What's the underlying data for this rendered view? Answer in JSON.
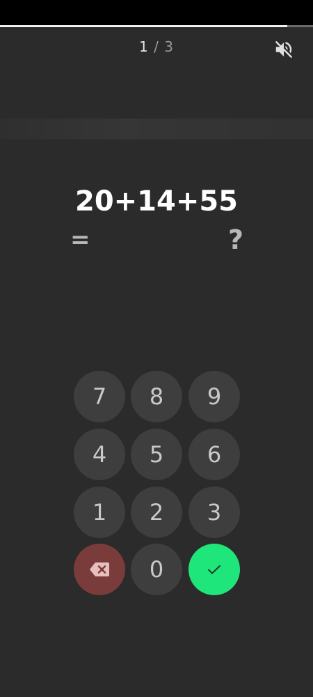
{
  "progress": {
    "fraction": 0.917
  },
  "counter": {
    "current": "1",
    "separator": " / ",
    "total": "3"
  },
  "mute_icon": "volume-off-icon",
  "question": {
    "expression": "20+14+55",
    "equals": "=",
    "answer": "",
    "placeholder": "?"
  },
  "keypad": {
    "keys": [
      "7",
      "8",
      "9",
      "4",
      "5",
      "6",
      "1",
      "2",
      "3"
    ],
    "zero": "0",
    "backspace_icon": "backspace-icon",
    "submit_icon": "check-icon"
  },
  "colors": {
    "accent_green": "#1fe67a",
    "delete_red": "#7a3c3a",
    "key_bg": "#3e3e3e",
    "background": "#2b2b2b"
  }
}
